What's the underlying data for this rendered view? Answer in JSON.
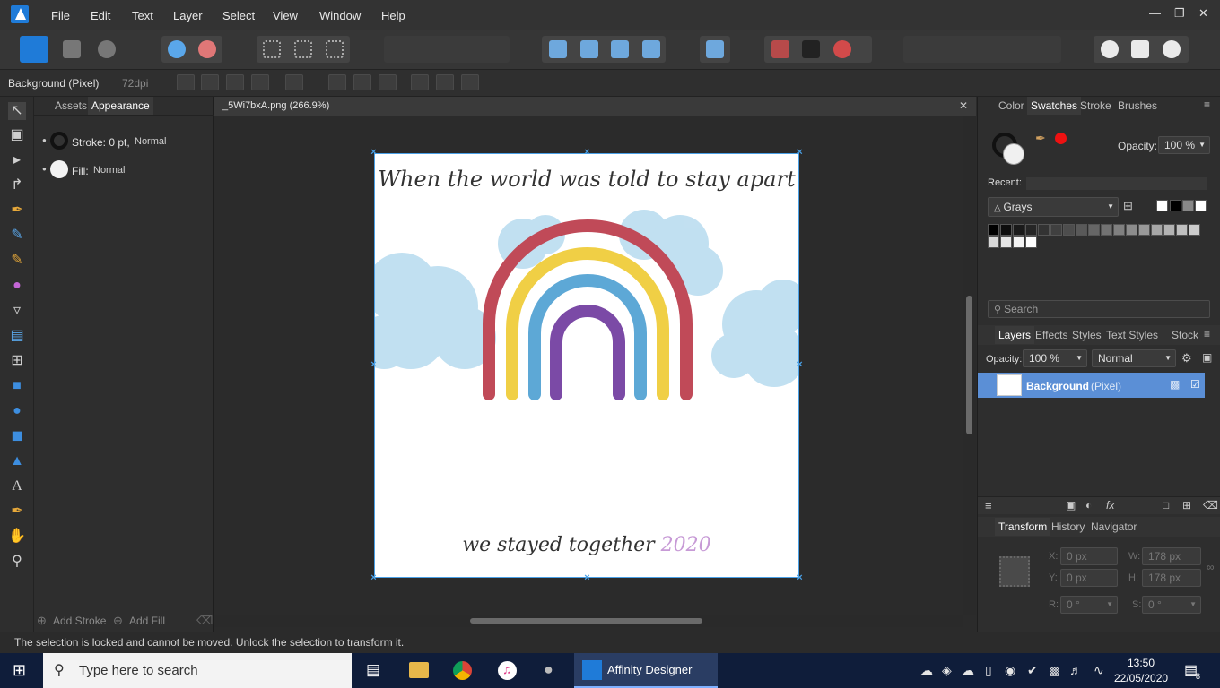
{
  "app": {
    "name": "Affinity Designer",
    "accent": "#1f7bd8"
  },
  "menu": [
    "File",
    "Edit",
    "Text",
    "Layer",
    "Select",
    "View",
    "Window",
    "Help"
  ],
  "context": {
    "layer_name": "Background (Pixel)",
    "dpi": "72dpi"
  },
  "left_panel": {
    "tabs": [
      "Assets",
      "Appearance"
    ],
    "stroke_label": "Stroke: 0 pt,",
    "stroke_mode": "Normal",
    "fill_label": "Fill:",
    "fill_mode": "Normal",
    "add_stroke": "Add Stroke",
    "add_fill": "Add Fill"
  },
  "document": {
    "tab_title": "_5Wi7bxA.png (266.9%)",
    "heading": "When the world was told to stay apart",
    "footer_text": "we stayed together",
    "year": "2020"
  },
  "right_panel": {
    "top_tabs": [
      "Color",
      "Swatches",
      "Stroke",
      "Brushes"
    ],
    "opacity_label": "Opacity:",
    "opacity_value": "100 %",
    "recent_label": "Recent:",
    "palette_name": "Grays",
    "search_placeholder": "Search",
    "layer_tabs": [
      "Layers",
      "Effects",
      "Styles",
      "Text Styles",
      "Stock"
    ],
    "layer_opacity_label": "Opacity:",
    "layer_opacity": "100 %",
    "blend_mode": "Normal",
    "layer_name": "Background",
    "layer_type": "(Pixel)",
    "transform_tabs": [
      "Transform",
      "History",
      "Navigator"
    ],
    "transform": {
      "x_label": "X:",
      "x": "0 px",
      "y_label": "Y:",
      "y": "0 px",
      "w_label": "W:",
      "w": "178 px",
      "h_label": "H:",
      "h": "178 px",
      "r_label": "R:",
      "r": "0 °",
      "s_label": "S:",
      "s": "0 °"
    }
  },
  "status": "The selection is locked and cannot be moved. Unlock the selection to transform it.",
  "taskbar": {
    "search_placeholder": "Type here to search",
    "active_app": "Affinity Designer",
    "time": "13:50",
    "date": "22/05/2020",
    "notifications": "8"
  }
}
